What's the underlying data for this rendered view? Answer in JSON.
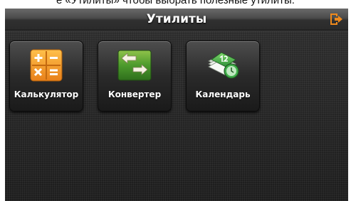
{
  "caption": {
    "text": "е «Утилиты» чтобы выбрать полезные утилиты."
  },
  "header": {
    "title": "Утилиты",
    "exit_icon": "exit-arrow-icon"
  },
  "tiles": [
    {
      "label": "Калькулятор",
      "icon": "calculator-icon"
    },
    {
      "label": "Конвертер",
      "icon": "converter-icon"
    },
    {
      "label": "Календарь",
      "icon": "calendar-icon"
    }
  ],
  "colors": {
    "accent_orange": "#f08a1c",
    "calculator_orange": "#f29a2a",
    "converter_green": "#3f8d2c",
    "calendar_green": "#3fae4a"
  }
}
